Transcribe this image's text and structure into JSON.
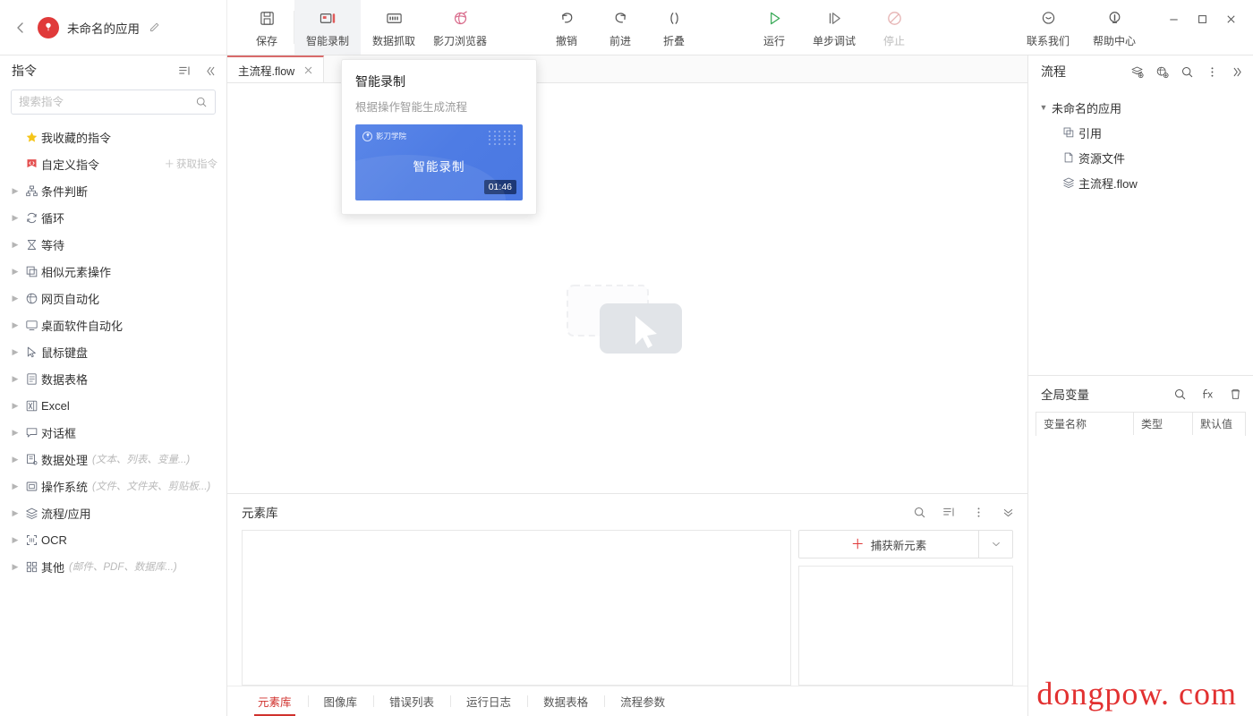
{
  "window": {
    "app_title": "未命名的应用",
    "back_icon": "chevron-left-icon",
    "edit_icon": "pencil-icon",
    "minimize": "–",
    "maximize": "□",
    "close": "×"
  },
  "toolbar": {
    "groups": [
      {
        "items": [
          {
            "label": "保存",
            "icon": "save-icon",
            "state": "normal"
          }
        ]
      },
      {
        "items": [
          {
            "label": "智能录制",
            "icon": "smart-record-icon",
            "state": "active"
          },
          {
            "label": "数据抓取",
            "icon": "data-capture-icon",
            "state": "normal"
          },
          {
            "label": "影刀浏览器",
            "icon": "browser-icon",
            "state": "normal"
          }
        ]
      },
      {
        "items": [
          {
            "label": "撤销",
            "icon": "undo-icon",
            "state": "normal"
          },
          {
            "label": "前进",
            "icon": "redo-icon",
            "state": "normal"
          },
          {
            "label": "折叠",
            "icon": "collapse-icon",
            "state": "normal"
          }
        ]
      },
      {
        "items": [
          {
            "label": "运行",
            "icon": "run-icon",
            "state": "normal"
          },
          {
            "label": "单步调试",
            "icon": "step-debug-icon",
            "state": "normal"
          },
          {
            "label": "停止",
            "icon": "stop-icon",
            "state": "disabled"
          }
        ]
      }
    ],
    "right_items": [
      {
        "label": "联系我们",
        "icon": "contact-icon"
      },
      {
        "label": "帮助中心",
        "icon": "help-icon"
      }
    ]
  },
  "left_panel": {
    "title": "指令",
    "sort_icon": "sort-list-icon",
    "collapse_icon": "double-chevron-left-icon",
    "search": {
      "placeholder": "搜索指令",
      "value": "",
      "icon": "search-icon"
    },
    "items": [
      {
        "label": "我收藏的指令",
        "icon": "star-icon",
        "expandable": false,
        "sub": "",
        "action": ""
      },
      {
        "label": "自定义指令",
        "icon": "custom-cmd-icon",
        "expandable": false,
        "sub": "",
        "action": "获取指令",
        "action_icon": "plus-icon"
      },
      {
        "label": "条件判断",
        "icon": "branch-icon",
        "expandable": true,
        "sub": ""
      },
      {
        "label": "循环",
        "icon": "loop-icon",
        "expandable": true,
        "sub": ""
      },
      {
        "label": "等待",
        "icon": "hourglass-icon",
        "expandable": true,
        "sub": ""
      },
      {
        "label": "相似元素操作",
        "icon": "similar-elements-icon",
        "expandable": true,
        "sub": ""
      },
      {
        "label": "网页自动化",
        "icon": "web-automation-icon",
        "expandable": true,
        "sub": ""
      },
      {
        "label": "桌面软件自动化",
        "icon": "desktop-automation-icon",
        "expandable": true,
        "sub": ""
      },
      {
        "label": "鼠标键盘",
        "icon": "mouse-keyboard-icon",
        "expandable": true,
        "sub": ""
      },
      {
        "label": "数据表格",
        "icon": "datatable-icon",
        "expandable": true,
        "sub": ""
      },
      {
        "label": "Excel",
        "icon": "excel-icon",
        "expandable": true,
        "sub": ""
      },
      {
        "label": "对话框",
        "icon": "dialog-icon",
        "expandable": true,
        "sub": ""
      },
      {
        "label": "数据处理",
        "icon": "data-process-icon",
        "expandable": true,
        "sub": "(文本、列表、变量...)"
      },
      {
        "label": "操作系统",
        "icon": "os-icon",
        "expandable": true,
        "sub": "(文件、文件夹、剪贴板...)"
      },
      {
        "label": "流程/应用",
        "icon": "flow-app-icon",
        "expandable": true,
        "sub": ""
      },
      {
        "label": "OCR",
        "icon": "ocr-icon",
        "expandable": true,
        "sub": ""
      },
      {
        "label": "其他",
        "icon": "other-icon",
        "expandable": true,
        "sub": "(邮件、PDF、数据库...)"
      }
    ]
  },
  "center": {
    "file_tabs": [
      {
        "label": "主流程.flow",
        "close_icon": "close-icon",
        "active": true
      }
    ],
    "canvas_placeholder_icon": "drag-drop-cursor-placeholder"
  },
  "popup": {
    "title": "智能录制",
    "description": "根据操作智能生成流程",
    "thumb": {
      "brand": "影刀学院",
      "brand_icon": "shadow-blade-logo-icon",
      "caption": "智能录制",
      "duration": "01:46"
    }
  },
  "dock": {
    "title": "元素库",
    "icons": [
      "search-icon",
      "sort-list-icon",
      "more-vertical-icon",
      "chevron-double-down-icon"
    ],
    "capture_button": {
      "label": "捕获新元素",
      "plus_icon": "plus-icon",
      "caret_icon": "chevron-down-icon"
    },
    "tabs": [
      {
        "label": "元素库",
        "selected": true
      },
      {
        "label": "图像库",
        "selected": false
      },
      {
        "label": "错误列表",
        "selected": false
      },
      {
        "label": "运行日志",
        "selected": false
      },
      {
        "label": "数据表格",
        "selected": false
      },
      {
        "label": "流程参数",
        "selected": false
      }
    ]
  },
  "right_panel": {
    "title": "流程",
    "icons": [
      "add-flow-icon",
      "add-app-icon",
      "search-icon",
      "more-vertical-icon",
      "chevron-double-right-icon"
    ],
    "tree": [
      {
        "label": "未命名的应用",
        "icon": "",
        "level": 0,
        "expanded": true,
        "caret": "▾"
      },
      {
        "label": "引用",
        "icon": "reference-icon",
        "level": 1
      },
      {
        "label": "资源文件",
        "icon": "resource-file-icon",
        "level": 1
      },
      {
        "label": "主流程.flow",
        "icon": "flow-icon",
        "level": 1
      }
    ],
    "globals": {
      "title": "全局变量",
      "icons": [
        "search-icon",
        "function-add-icon",
        "delete-icon"
      ],
      "columns": [
        "变量名称",
        "类型",
        "默认值"
      ],
      "rows": []
    }
  },
  "watermark": {
    "text": "dongpow. com",
    "color": "#e02020"
  },
  "colors": {
    "accent": "#e03a3a",
    "tab_active": "#d0312d",
    "popup_blue": "#4e7ce4"
  }
}
